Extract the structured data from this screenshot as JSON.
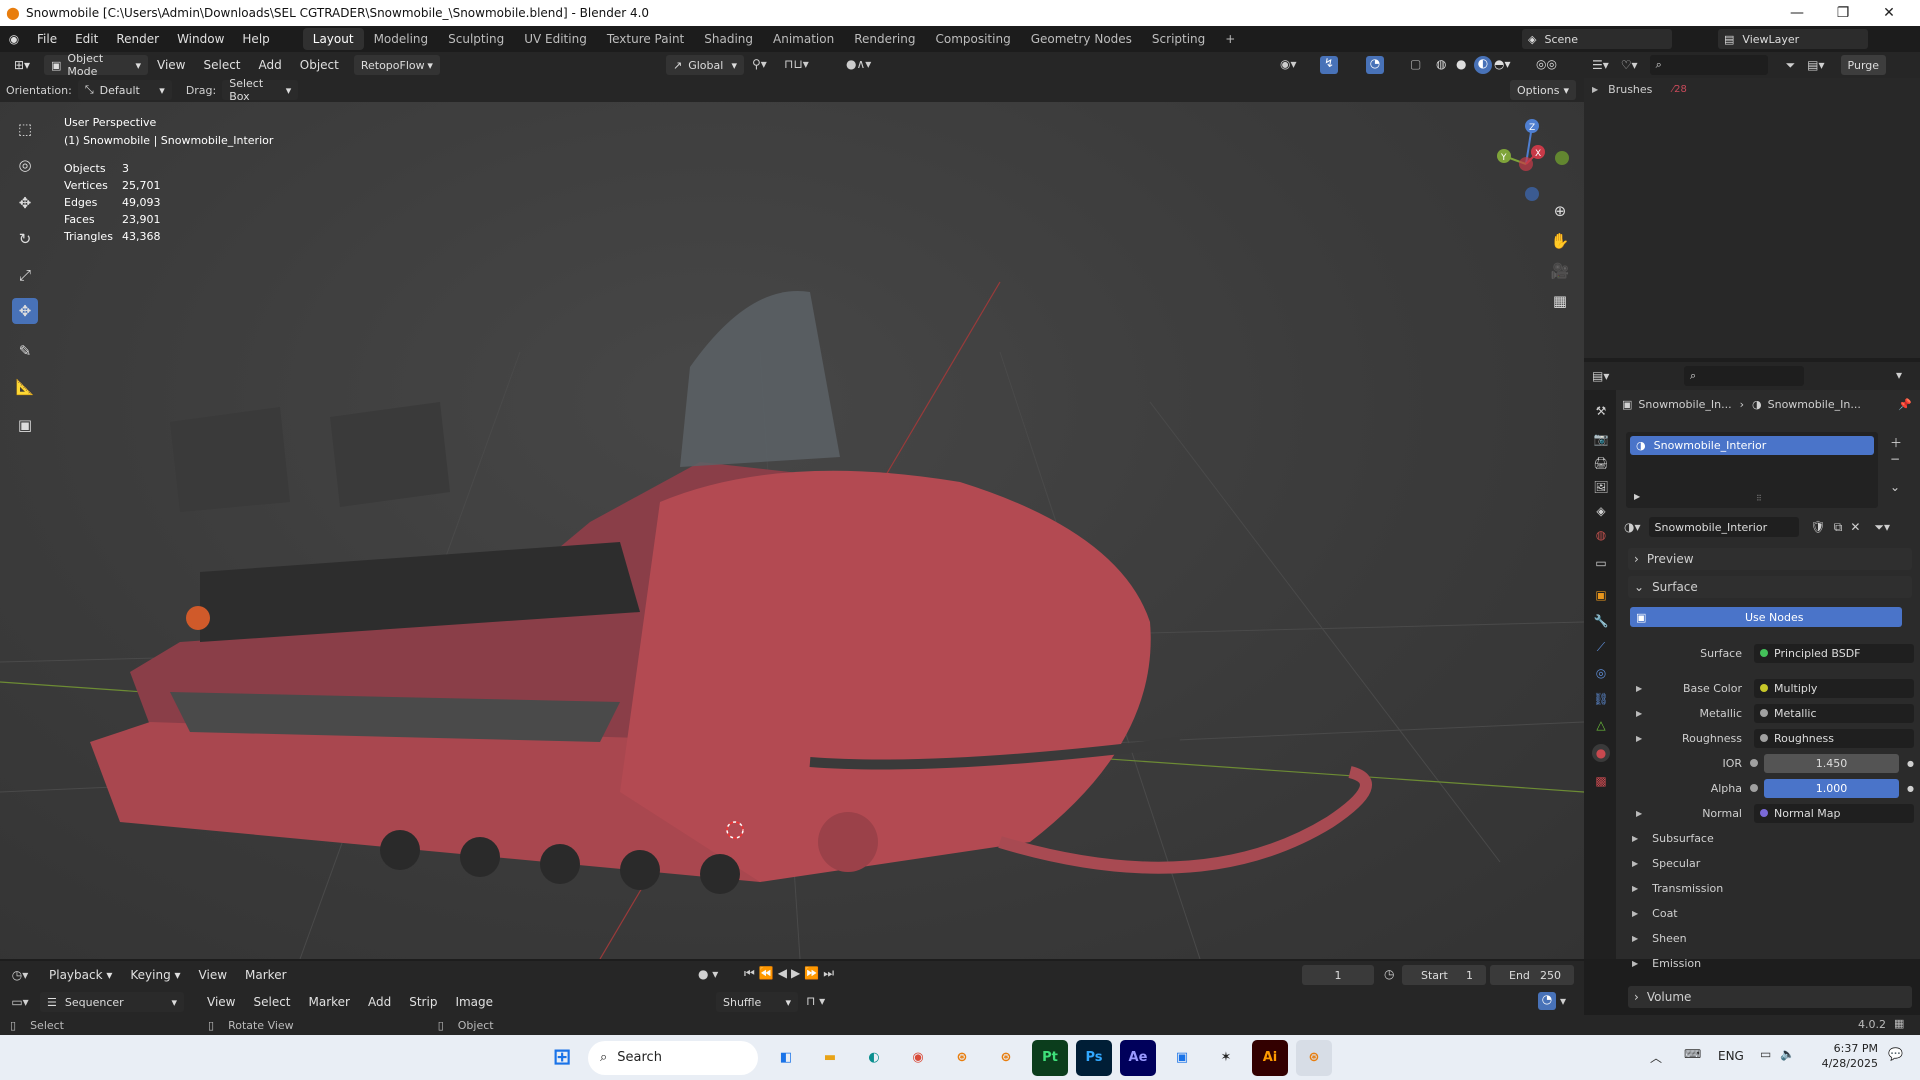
{
  "titlebar": {
    "title": "Snowmobile [C:\\Users\\Admin\\Downloads\\SEL CGTRADER\\Snowmobile_\\Snowmobile.blend] - Blender 4.0",
    "minimize": "—",
    "maximize": "❐",
    "close": "✕"
  },
  "menu": [
    "File",
    "Edit",
    "Render",
    "Window",
    "Help"
  ],
  "workspaces": [
    "Layout",
    "Modeling",
    "Sculpting",
    "UV Editing",
    "Texture Paint",
    "Shading",
    "Animation",
    "Rendering",
    "Compositing",
    "Geometry Nodes",
    "Scripting"
  ],
  "add_workspace": "+",
  "scene": {
    "label": "Scene",
    "viewlayer": "ViewLayer"
  },
  "viewport_header": {
    "mode": "Object Mode",
    "menus": [
      "View",
      "Select",
      "Add",
      "Object"
    ],
    "addon": "RetopoFlow",
    "transform": "Global"
  },
  "toolsettings": {
    "orientation_label": "Orientation:",
    "orientation": "Default",
    "drag_label": "Drag:",
    "drag": "Select Box",
    "options": "Options"
  },
  "viewport": {
    "perspective": "User Perspective",
    "object": "(1) Snowmobile | Snowmobile_Interior",
    "stats": [
      {
        "k": "Objects",
        "v": "3"
      },
      {
        "k": "Vertices",
        "v": "25,701"
      },
      {
        "k": "Edges",
        "v": "49,093"
      },
      {
        "k": "Faces",
        "v": "23,901"
      },
      {
        "k": "Triangles",
        "v": "43,368"
      }
    ],
    "gizmo": {
      "z": "Z",
      "y": "Y",
      "x": "X"
    }
  },
  "outliner": {
    "brushes": "Brushes",
    "purge": "Purge"
  },
  "properties": {
    "breadcrumb_obj": "Snowmobile_In...",
    "breadcrumb_mat": "Snowmobile_In...",
    "slot": "Snowmobile_Interior",
    "material": "Snowmobile_Interior",
    "preview": "Preview",
    "surface_panel": "Surface",
    "use_nodes": "Use Nodes",
    "surface_label": "Surface",
    "surface_value": "Principled BSDF",
    "rows": [
      {
        "label": "Base Color",
        "value": "Multiply"
      },
      {
        "label": "Metallic",
        "value": "Metallic"
      },
      {
        "label": "Roughness",
        "value": "Roughness"
      },
      {
        "label": "IOR",
        "value": "1.450"
      },
      {
        "label": "Alpha",
        "value": "1.000"
      },
      {
        "label": "Normal",
        "value": "Normal Map"
      }
    ],
    "subpanels": [
      "Subsurface",
      "Specular",
      "Transmission",
      "Coat",
      "Sheen",
      "Emission"
    ],
    "volume": "Volume"
  },
  "timeline": {
    "menus": [
      "Playback",
      "Keying",
      "View",
      "Marker"
    ],
    "frame": "1",
    "start_label": "Start",
    "start": "1",
    "end_label": "End",
    "end": "250"
  },
  "sequencer": {
    "type": "Sequencer",
    "menus": [
      "View",
      "Select",
      "Marker",
      "Add",
      "Strip",
      "Image"
    ],
    "shuffle": "Shuffle"
  },
  "statusbar": {
    "select": "Select",
    "rotate": "Rotate View",
    "object": "Object",
    "version": "4.0.2"
  },
  "taskbar": {
    "search": "Search",
    "lang": "ENG",
    "time": "6:37 PM",
    "date": "4/28/2025",
    "apps": [
      "Pt",
      "Ps",
      "Ae",
      "Ai"
    ]
  },
  "colors": {
    "accent": "#4a74c9",
    "body": "#b8454f",
    "orange": "#e87d0d"
  }
}
